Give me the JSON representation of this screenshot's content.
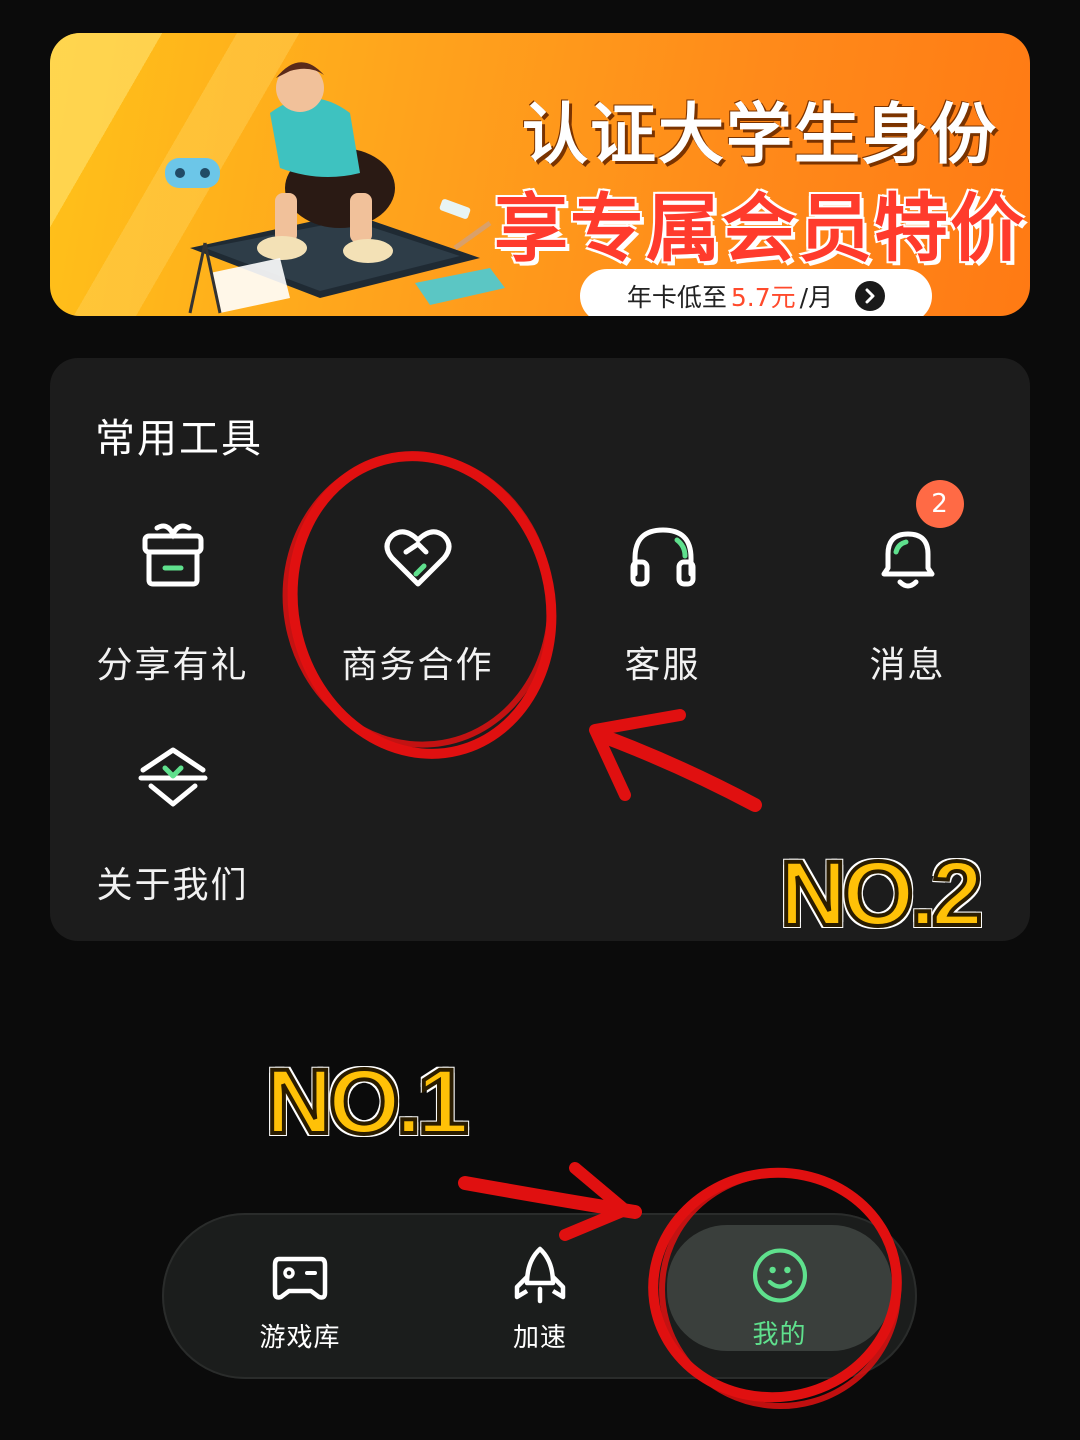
{
  "banner": {
    "title": "认证大学生身份",
    "subtitle": "享专属会员特价",
    "pill_prefix": "年卡低至",
    "pill_price": "5.7元",
    "pill_suffix": "/月"
  },
  "tools": {
    "title": "常用工具",
    "items": [
      {
        "label": "分享有礼",
        "icon": "gift-box-icon"
      },
      {
        "label": "商务合作",
        "icon": "heart-handshake-icon"
      },
      {
        "label": "客服",
        "icon": "headset-icon"
      },
      {
        "label": "消息",
        "icon": "bell-icon",
        "badge": "2"
      },
      {
        "label": "关于我们",
        "icon": "about-shield-icon"
      }
    ]
  },
  "annotations": {
    "no1": "NO.1",
    "no2": "NO.2"
  },
  "nav": {
    "items": [
      {
        "label": "游戏库",
        "icon": "gamepad-icon",
        "active": false
      },
      {
        "label": "加速",
        "icon": "rocket-icon",
        "active": false
      },
      {
        "label": "我的",
        "icon": "smiley-icon",
        "active": true
      }
    ]
  },
  "colors": {
    "accent_green": "#5fe08d",
    "badge": "#ff6a45",
    "annotation_red": "#e01010",
    "annotation_yellow": "#ffc107"
  }
}
